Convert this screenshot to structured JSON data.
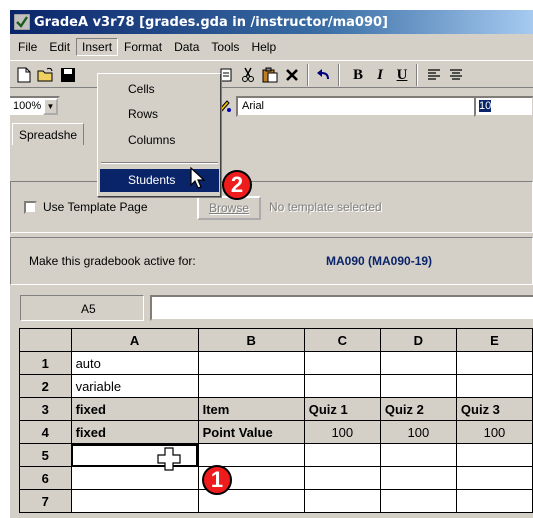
{
  "window": {
    "title": "GradeA v3r78 [grades.gda in /instructor/ma090]"
  },
  "menubar": {
    "items": [
      "File",
      "Edit",
      "Insert",
      "Format",
      "Data",
      "Tools",
      "Help"
    ],
    "active": "Insert"
  },
  "insert_menu": {
    "items": [
      "Cells",
      "Rows",
      "Columns",
      "Students"
    ],
    "highlighted": "Students"
  },
  "toolbar": {
    "zoom": "100%",
    "font": "Arial",
    "font_size": "10"
  },
  "tabs": {
    "current": "Spreadshe"
  },
  "template": {
    "checkbox_label": "Use Template Page",
    "browse_label": "Browse",
    "status": "No template selected"
  },
  "active_panel": {
    "label": "Make this gradebook active for:",
    "value": "MA090 (MA090-19)"
  },
  "formula_bar": {
    "cell_reference": "A5",
    "content": ""
  },
  "sheet": {
    "columns": [
      "A",
      "B",
      "C",
      "D",
      "E"
    ],
    "rows": [
      {
        "num": "1",
        "cells": [
          "auto",
          "",
          "",
          "",
          ""
        ]
      },
      {
        "num": "2",
        "cells": [
          "variable",
          "",
          "",
          "",
          ""
        ]
      },
      {
        "num": "3",
        "cells": [
          "fixed",
          "Item",
          "Quiz 1",
          "Quiz 2",
          "Quiz 3"
        ]
      },
      {
        "num": "4",
        "cells": [
          "fixed",
          "Point Value",
          "100",
          "100",
          "100"
        ]
      },
      {
        "num": "5",
        "cells": [
          "",
          "",
          "",
          "",
          ""
        ]
      },
      {
        "num": "6",
        "cells": [
          "",
          "",
          "",
          "",
          ""
        ]
      },
      {
        "num": "7",
        "cells": [
          "",
          "",
          "",
          "",
          ""
        ]
      }
    ]
  },
  "callouts": [
    "1",
    "2"
  ],
  "colors": {
    "titlebar": "#0a246a",
    "highlight": "#0a246a",
    "callout": "#ee1c1c",
    "chrome": "#d4d0c8"
  }
}
